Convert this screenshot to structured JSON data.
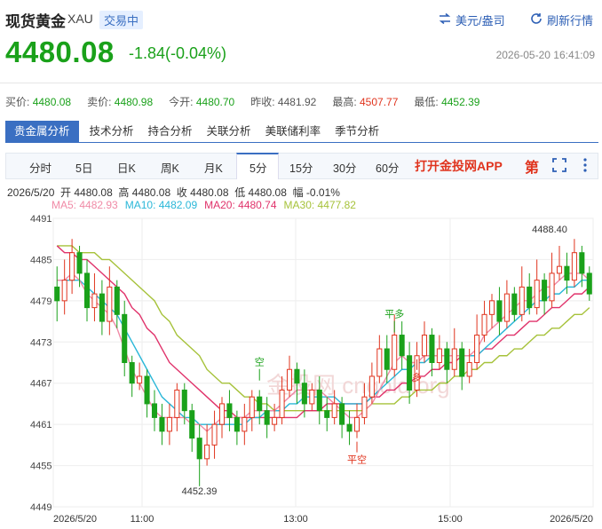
{
  "header": {
    "title": "现货黄金",
    "code": "XAU",
    "status_badge": "交易中",
    "currency_btn": "美元/盎司",
    "refresh_btn": "刷新行情"
  },
  "quote": {
    "price": "4480.08",
    "change": "-1.84(-0.04%)",
    "datetime": "2026-05-20 16:41:09"
  },
  "summary": {
    "bid_label": "买价:",
    "bid": "4480.08",
    "ask_label": "卖价:",
    "ask": "4480.98",
    "open_label": "今开:",
    "open": "4480.70",
    "prev_label": "昨收:",
    "prev": "4481.92",
    "high_label": "最高:",
    "high": "4507.77",
    "low_label": "最低:",
    "low": "4452.39"
  },
  "analysis_tabs": [
    "贵金属分析",
    "技术分析",
    "持合分析",
    "关联分析",
    "美联储利率",
    "季节分析"
  ],
  "periods": [
    "分时",
    "5日",
    "日K",
    "周K",
    "月K",
    "5分",
    "15分",
    "30分",
    "60分"
  ],
  "active_period": "5分",
  "promo": "打开金投网APP",
  "promo_logo": "第",
  "info_line": "2026/5/20  开 4480.08  高 4480.08  收 4480.08  低 4480.08  幅 -0.01%",
  "ma": {
    "ma5": "MA5: 4482.93",
    "ma10": "MA10: 4482.09",
    "ma20": "MA20: 4480.74",
    "ma30": "MA30: 4477.82"
  },
  "colors": {
    "up": "#e0341e",
    "down": "#1aa11a",
    "ma5": "#f08aa6",
    "ma10": "#2ab7d8",
    "ma20": "#e0336b",
    "ma30": "#a6c23a",
    "accent": "#3a6fc2"
  },
  "markers": {
    "kong": "空",
    "pingkong": "平空",
    "duo": "多",
    "pingduo": "平多"
  },
  "watermark": "金投网 cngold.org",
  "chart_data": {
    "type": "candlestick",
    "ylim": [
      4449,
      4491
    ],
    "yticks": [
      4449,
      4455,
      4461,
      4467,
      4473,
      4479,
      4485,
      4491
    ],
    "xlabels": [
      "2026/5/20",
      "11:00",
      "13:00",
      "15:00",
      "2026/5/20"
    ],
    "high_label": "4488.40",
    "low_label": "4452.39",
    "candles": [
      [
        4481,
        4479,
        4484,
        4476
      ],
      [
        4479,
        4482,
        4485,
        4477
      ],
      [
        4482,
        4486,
        4488,
        4480
      ],
      [
        4486,
        4483,
        4487,
        4481
      ],
      [
        4483,
        4478,
        4485,
        4476
      ],
      [
        4478,
        4480,
        4483,
        4476
      ],
      [
        4480,
        4476,
        4482,
        4474
      ],
      [
        4476,
        4481,
        4484,
        4474
      ],
      [
        4481,
        4477,
        4482,
        4475
      ],
      [
        4477,
        4470,
        4479,
        4468
      ],
      [
        4470,
        4467,
        4471,
        4465
      ],
      [
        4467,
        4468,
        4470,
        4466
      ],
      [
        4468,
        4464,
        4469,
        4462
      ],
      [
        4464,
        4462,
        4466,
        4460
      ],
      [
        4462,
        4460,
        4464,
        4458
      ],
      [
        4460,
        4462,
        4464,
        4458
      ],
      [
        4462,
        4466,
        4467,
        4460
      ],
      [
        4466,
        4463,
        4467,
        4461
      ],
      [
        4463,
        4459,
        4464,
        4457
      ],
      [
        4459,
        4456,
        4461,
        4452
      ],
      [
        4456,
        4458,
        4461,
        4455
      ],
      [
        4458,
        4461,
        4463,
        4456
      ],
      [
        4461,
        4464,
        4465,
        4459
      ],
      [
        4464,
        4462,
        4466,
        4460
      ],
      [
        4462,
        4460,
        4463,
        4458
      ],
      [
        4460,
        4462,
        4464,
        4458
      ],
      [
        4462,
        4465,
        4466,
        4460
      ],
      [
        4465,
        4463,
        4466,
        4461
      ],
      [
        4463,
        4461,
        4465,
        4459
      ],
      [
        4461,
        4462,
        4464,
        4460
      ],
      [
        4462,
        4466,
        4468,
        4461
      ],
      [
        4466,
        4469,
        4471,
        4465
      ],
      [
        4469,
        4467,
        4470,
        4464
      ],
      [
        4467,
        4464,
        4469,
        4462
      ],
      [
        4464,
        4466,
        4467,
        4463
      ],
      [
        4466,
        4463,
        4468,
        4461
      ],
      [
        4463,
        4462,
        4465,
        4460
      ],
      [
        4462,
        4464,
        4466,
        4461
      ],
      [
        4464,
        4461,
        4465,
        4459
      ],
      [
        4461,
        4460,
        4463,
        4458
      ],
      [
        4460,
        4462,
        4464,
        4459
      ],
      [
        4462,
        4465,
        4467,
        4461
      ],
      [
        4465,
        4468,
        4470,
        4464
      ],
      [
        4468,
        4472,
        4474,
        4467
      ],
      [
        4472,
        4469,
        4474,
        4467
      ],
      [
        4469,
        4474,
        4477,
        4468
      ],
      [
        4474,
        4471,
        4476,
        4469
      ],
      [
        4471,
        4466,
        4473,
        4464
      ],
      [
        4466,
        4471,
        4473,
        4465
      ],
      [
        4471,
        4474,
        4476,
        4470
      ],
      [
        4474,
        4470,
        4475,
        4468
      ],
      [
        4470,
        4472,
        4474,
        4469
      ],
      [
        4472,
        4469,
        4473,
        4467
      ],
      [
        4469,
        4472,
        4475,
        4468
      ],
      [
        4472,
        4468,
        4473,
        4466
      ],
      [
        4468,
        4470,
        4472,
        4467
      ],
      [
        4470,
        4474,
        4477,
        4469
      ],
      [
        4474,
        4477,
        4479,
        4473
      ],
      [
        4477,
        4479,
        4480,
        4475
      ],
      [
        4479,
        4476,
        4481,
        4474
      ],
      [
        4476,
        4480,
        4482,
        4475
      ],
      [
        4480,
        4477,
        4481,
        4476
      ],
      [
        4477,
        4481,
        4484,
        4476
      ],
      [
        4481,
        4478,
        4483,
        4477
      ],
      [
        4478,
        4482,
        4485,
        4477
      ],
      [
        4482,
        4479,
        4483,
        4477
      ],
      [
        4479,
        4483,
        4486,
        4478
      ],
      [
        4483,
        4484,
        4487,
        4482
      ],
      [
        4484,
        4482,
        4486,
        4480
      ],
      [
        4482,
        4486,
        4488,
        4481
      ],
      [
        4486,
        4483,
        4487,
        4481
      ],
      [
        4483,
        4480,
        4484,
        4479
      ]
    ],
    "ma5": [
      4482,
      4482,
      4483,
      4482,
      4480,
      4479,
      4478,
      4477,
      4475,
      4472,
      4469,
      4467,
      4465,
      4463,
      4462,
      4462,
      4462,
      4462,
      4461,
      4461,
      4460,
      4461,
      4462,
      4462,
      4462,
      4462,
      4463,
      4463,
      4463,
      4463,
      4464,
      4465,
      4466,
      4466,
      4466,
      4466,
      4465,
      4464,
      4463,
      4462,
      4462,
      4463,
      4464,
      4466,
      4468,
      4470,
      4471,
      4470,
      4470,
      4471,
      4471,
      4471,
      4471,
      4471,
      4471,
      4471,
      4472,
      4474,
      4475,
      4476,
      4477,
      4478,
      4479,
      4479,
      4480,
      4481,
      4481,
      4482,
      4483,
      4483,
      4483,
      4482
    ],
    "ma10": [
      4482,
      4482,
      4482,
      4482,
      4481,
      4480,
      4479,
      4478,
      4477,
      4475,
      4473,
      4471,
      4469,
      4467,
      4465,
      4464,
      4463,
      4462,
      4462,
      4461,
      4461,
      4461,
      4461,
      4461,
      4461,
      4461,
      4462,
      4462,
      4463,
      4463,
      4463,
      4464,
      4464,
      4465,
      4465,
      4465,
      4465,
      4465,
      4464,
      4464,
      4464,
      4464,
      4465,
      4466,
      4467,
      4468,
      4469,
      4469,
      4470,
      4470,
      4471,
      4471,
      4471,
      4471,
      4471,
      4471,
      4471,
      4472,
      4473,
      4474,
      4475,
      4476,
      4477,
      4478,
      4479,
      4479,
      4480,
      4480,
      4481,
      4481,
      4482,
      4482
    ],
    "ma20": [
      4487,
      4486,
      4486,
      4485,
      4485,
      4484,
      4483,
      4482,
      4481,
      4480,
      4478,
      4477,
      4475,
      4474,
      4472,
      4470,
      4469,
      4468,
      4467,
      4466,
      4465,
      4464,
      4463,
      4463,
      4462,
      4462,
      4462,
      4462,
      4462,
      4462,
      4462,
      4462,
      4462,
      4463,
      4463,
      4463,
      4464,
      4464,
      4464,
      4464,
      4464,
      4464,
      4465,
      4465,
      4466,
      4466,
      4467,
      4467,
      4468,
      4468,
      4469,
      4469,
      4470,
      4470,
      4471,
      4471,
      4471,
      4472,
      4472,
      4473,
      4474,
      4474,
      4475,
      4476,
      4476,
      4477,
      4478,
      4478,
      4479,
      4480,
      4480,
      4481
    ],
    "ma30": [
      4487,
      4487,
      4487,
      4486,
      4486,
      4486,
      4485,
      4485,
      4484,
      4483,
      4482,
      4481,
      4480,
      4479,
      4477,
      4476,
      4474,
      4473,
      4472,
      4471,
      4469,
      4468,
      4467,
      4467,
      4466,
      4465,
      4465,
      4464,
      4464,
      4463,
      4463,
      4463,
      4463,
      4463,
      4463,
      4463,
      4463,
      4463,
      4463,
      4463,
      4463,
      4463,
      4464,
      4464,
      4464,
      4464,
      4465,
      4465,
      4466,
      4466,
      4466,
      4467,
      4467,
      4468,
      4468,
      4469,
      4469,
      4470,
      4470,
      4471,
      4471,
      4472,
      4472,
      4473,
      4474,
      4474,
      4475,
      4475,
      4476,
      4477,
      4477,
      4478
    ]
  }
}
